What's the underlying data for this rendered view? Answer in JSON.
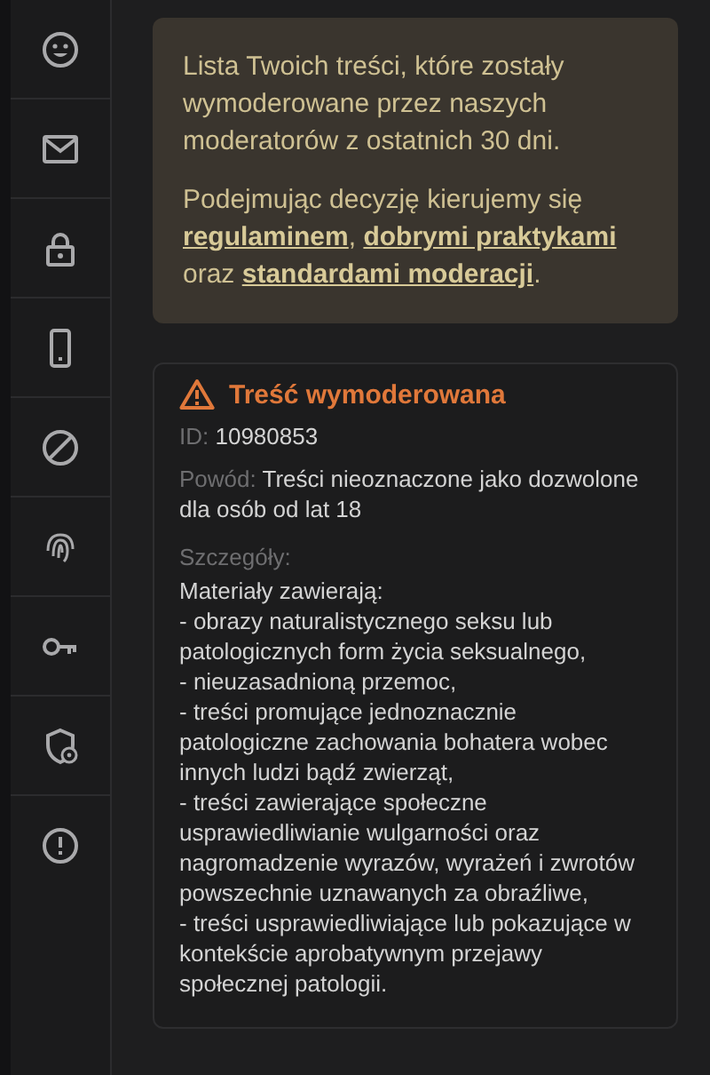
{
  "info_box": {
    "intro": "Lista Twoich treści, które zostały wymoderowane przez naszych moderatorów z ostatnich 30 dni.",
    "policy_parts": [
      {
        "kind": "text",
        "text": "Podejmując decyzję kierujemy się "
      },
      {
        "kind": "link",
        "text": "regulaminem"
      },
      {
        "kind": "text",
        "text": ", "
      },
      {
        "kind": "link",
        "text": "dobrymi praktykami"
      },
      {
        "kind": "text",
        "text": " oraz "
      },
      {
        "kind": "link",
        "text": "standardami moderacji"
      },
      {
        "kind": "text",
        "text": "."
      }
    ]
  },
  "moderation_card": {
    "title": "Treść wymoderowana",
    "id_label": "ID:",
    "id_value": "10980853",
    "reason_label": "Powód:",
    "reason_value": "Treści nieoznaczone jako dozwolone dla osób od lat 18",
    "details_label": "Szczegóły:",
    "details": [
      "Materiały zawierają:",
      "- obrazy naturalistycznego seksu lub patologicznych form życia seksualnego,",
      "- nieuzasadnioną przemoc,",
      "- treści promujące jednoznacznie patologiczne zachowania bohatera wobec innych ludzi bądź zwierząt,",
      "- treści zawierające społeczne usprawiedliwianie wulgarności oraz nagromadzenie wyrazów, wyrażeń i zwrotów powszechnie uznawanych za obraźliwe,",
      "- treści usprawiedliwiające lub pokazujące w kontekście aprobatywnym przejawy społecznej patologii."
    ]
  }
}
